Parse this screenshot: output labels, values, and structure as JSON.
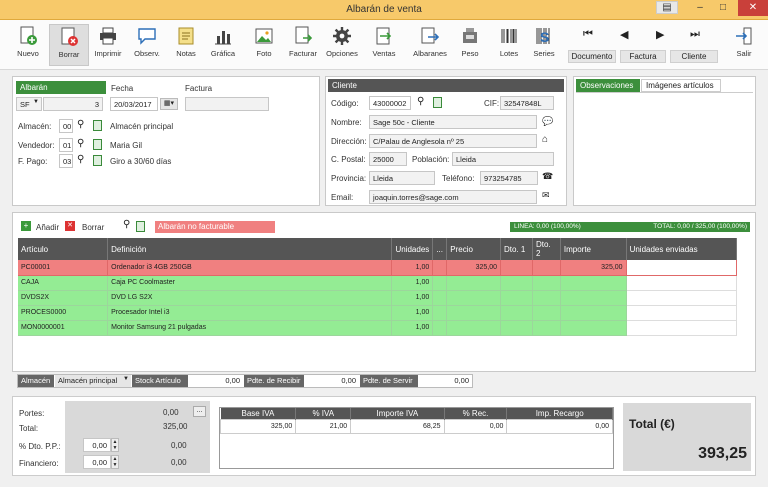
{
  "window": {
    "title": "Albarán de venta"
  },
  "toolbar": {
    "items": [
      {
        "label": "Nuevo",
        "icon": "new-doc-icon"
      },
      {
        "label": "Borrar",
        "icon": "delete-doc-icon"
      },
      {
        "label": "Imprimir",
        "icon": "printer-icon"
      },
      {
        "label": "Observ.",
        "icon": "comment-icon"
      },
      {
        "label": "Notas",
        "icon": "notes-icon"
      },
      {
        "label": "Gráfica",
        "icon": "chart-icon"
      },
      {
        "label": "Foto",
        "icon": "photo-icon"
      },
      {
        "label": "Facturar",
        "icon": "invoice-icon"
      },
      {
        "label": "Opciones",
        "icon": "gear-icon"
      },
      {
        "label": "Ventas",
        "icon": "sales-icon"
      },
      {
        "label": "Albaranes",
        "icon": "delivery-notes-icon"
      },
      {
        "label": "Peso",
        "icon": "scale-icon"
      },
      {
        "label": "Lotes",
        "icon": "barcode-icon"
      },
      {
        "label": "Series",
        "icon": "series-icon"
      },
      {
        "label": "Salir",
        "icon": "exit-icon"
      }
    ],
    "nav": {
      "documento": "Documento",
      "factura": "Factura",
      "cliente": "Cliente"
    }
  },
  "albaran": {
    "header": "Albarán",
    "serie": "SF",
    "numero": "3",
    "fecha_label": "Fecha",
    "fecha": "20/03/2017",
    "factura_label": "Factura",
    "factura": "",
    "almacen_label": "Almacén:",
    "almacen_code": "00",
    "almacen_name": "Almacén principal",
    "vendedor_label": "Vendedor:",
    "vendedor_code": "01",
    "vendedor_name": "Maria Gil",
    "fpago_label": "F. Pago:",
    "fpago_code": "03",
    "fpago_name": "Giro a 30/60 días"
  },
  "cliente": {
    "header": "Cliente",
    "codigo_label": "Código:",
    "codigo": "43000002",
    "cif_label": "CIF:",
    "cif": "32547848L",
    "nombre_label": "Nombre:",
    "nombre": "Sage 50c - Cliente",
    "direccion_label": "Dirección:",
    "direccion": "C/Palau de Anglesola nº 25",
    "cpostal_label": "C. Postal:",
    "cpostal": "25000",
    "poblacion_label": "Población:",
    "poblacion": "Lleida",
    "provincia_label": "Provincia:",
    "provincia": "Lleida",
    "telefono_label": "Teléfono:",
    "telefono": "973254785",
    "email_label": "Email:",
    "email": "joaquin.torres@sage.com"
  },
  "tabs": {
    "observaciones": "Observaciones",
    "imagenes": "Imágenes artículos"
  },
  "lines": {
    "add_label": "Añadir",
    "delete_label": "Borrar",
    "status": "Albarán no facturable",
    "linea_info": "LINEA: 0,00 (100,00%)",
    "total_info": "TOTAL: 0,00 / 325,00 (100,00%)",
    "columns": [
      "Artículo",
      "Definición",
      "Unidades",
      "...",
      "Precio",
      "Dto. 1",
      "Dto. 2",
      "Importe",
      "Unidades enviadas"
    ],
    "rows": [
      {
        "articulo": "PC00001",
        "definicion": "Ordenador i3 4GB 250GB",
        "unidades": "1,00",
        "precio": "325,00",
        "dto1": "",
        "dto2": "",
        "importe": "325,00",
        "enviadas": "",
        "style": "red"
      },
      {
        "articulo": "CAJA",
        "definicion": "Caja PC Coolmaster",
        "unidades": "1,00",
        "precio": "",
        "dto1": "",
        "dto2": "",
        "importe": "",
        "enviadas": "",
        "style": "green"
      },
      {
        "articulo": "DVDS2X",
        "definicion": "DVD LG S2X",
        "unidades": "1,00",
        "precio": "",
        "dto1": "",
        "dto2": "",
        "importe": "",
        "enviadas": "",
        "style": "green"
      },
      {
        "articulo": "PROCES0000",
        "definicion": "Procesador Intel i3",
        "unidades": "1,00",
        "precio": "",
        "dto1": "",
        "dto2": "",
        "importe": "",
        "enviadas": "",
        "style": "green"
      },
      {
        "articulo": "MON0000001",
        "definicion": "Monitor Samsung 21 pulgadas",
        "unidades": "1,00",
        "precio": "",
        "dto1": "",
        "dto2": "",
        "importe": "",
        "enviadas": "",
        "style": "green"
      }
    ]
  },
  "stockbar": {
    "almacen_label": "Almacén",
    "almacen_value": "Almacén principal",
    "stock_label": "Stock Artículo",
    "stock_value": "0,00",
    "recibir_label": "Pdte. de Recibir",
    "recibir_value": "0,00",
    "servir_label": "Pdte. de Servir",
    "servir_value": "0,00"
  },
  "totals": {
    "portes_label": "Portes:",
    "portes": "0,00",
    "total_label": "Total:",
    "total": "325,00",
    "dtopp_label": "% Dto. P.P.:",
    "dtopp": "0,00",
    "dtopp_amount": "0,00",
    "financiero_label": "Financiero:",
    "financiero": "0,00",
    "financiero_amount": "0,00",
    "iva_columns": [
      "Base IVA",
      "% IVA",
      "Importe IVA",
      "% Rec.",
      "Imp. Recargo"
    ],
    "iva_row": [
      "325,00",
      "21,00",
      "68,25",
      "0,00",
      "0,00"
    ],
    "grand_label": "Total (€)",
    "grand_total": "393,25"
  },
  "colors": {
    "accent_green": "#3c8f3c",
    "row_green": "#94ec94",
    "row_red": "#f08080",
    "titlebar": "#f7c96a"
  }
}
